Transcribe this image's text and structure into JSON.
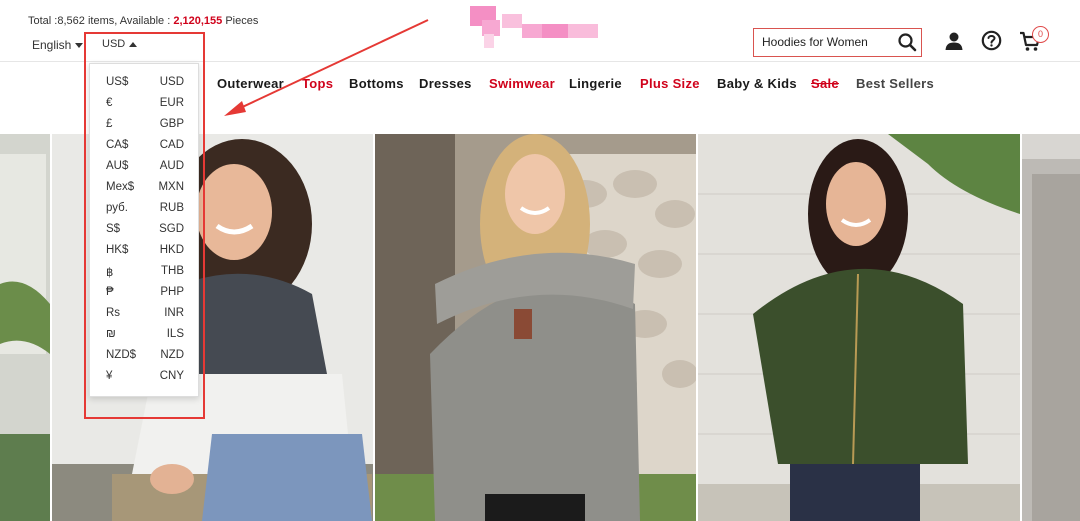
{
  "header": {
    "stock_prefix": "Total :",
    "items_count": "8,562",
    "items_label": " items, Available : ",
    "pieces_count": "2,120,155",
    "pieces_label": " Pieces",
    "language": "English",
    "currency": "USD",
    "search_value": "Hoodies for Women",
    "cart_count": "0"
  },
  "icons": {
    "search": "search-icon",
    "account": "user-icon",
    "help": "help-icon",
    "cart": "cart-icon"
  },
  "colors": {
    "accent_red": "#d0021b",
    "highlight_red": "#e53935",
    "logo_pink": "#f07fb8"
  },
  "nav": {
    "items": [
      {
        "label": "Outerwear",
        "style": "dark"
      },
      {
        "label": "Tops",
        "style": "red"
      },
      {
        "label": "Bottoms",
        "style": "dark"
      },
      {
        "label": "Dresses",
        "style": "dark"
      },
      {
        "label": "Swimwear",
        "style": "red"
      },
      {
        "label": "Lingerie",
        "style": "dark"
      },
      {
        "label": "Plus Size",
        "style": "red"
      },
      {
        "label": "Baby & Kids",
        "style": "dark"
      },
      {
        "label": "Sale",
        "style": "red-strike"
      },
      {
        "label": "Best Sellers",
        "style": "gray"
      }
    ]
  },
  "currencies": [
    {
      "symbol": "US$",
      "code": "USD"
    },
    {
      "symbol": "€",
      "code": "EUR"
    },
    {
      "symbol": "£",
      "code": "GBP"
    },
    {
      "symbol": "CA$",
      "code": "CAD"
    },
    {
      "symbol": "AU$",
      "code": "AUD"
    },
    {
      "symbol": "Mex$",
      "code": "MXN"
    },
    {
      "symbol": "руб.",
      "code": "RUB"
    },
    {
      "symbol": "S$",
      "code": "SGD"
    },
    {
      "symbol": "HK$",
      "code": "HKD"
    },
    {
      "symbol": "฿",
      "code": "THB"
    },
    {
      "symbol": "₱",
      "code": "PHP"
    },
    {
      "symbol": "Rs",
      "code": "INR"
    },
    {
      "symbol": "₪",
      "code": "ILS"
    },
    {
      "symbol": "NZD$",
      "code": "NZD"
    },
    {
      "symbol": "¥",
      "code": "CNY"
    }
  ]
}
